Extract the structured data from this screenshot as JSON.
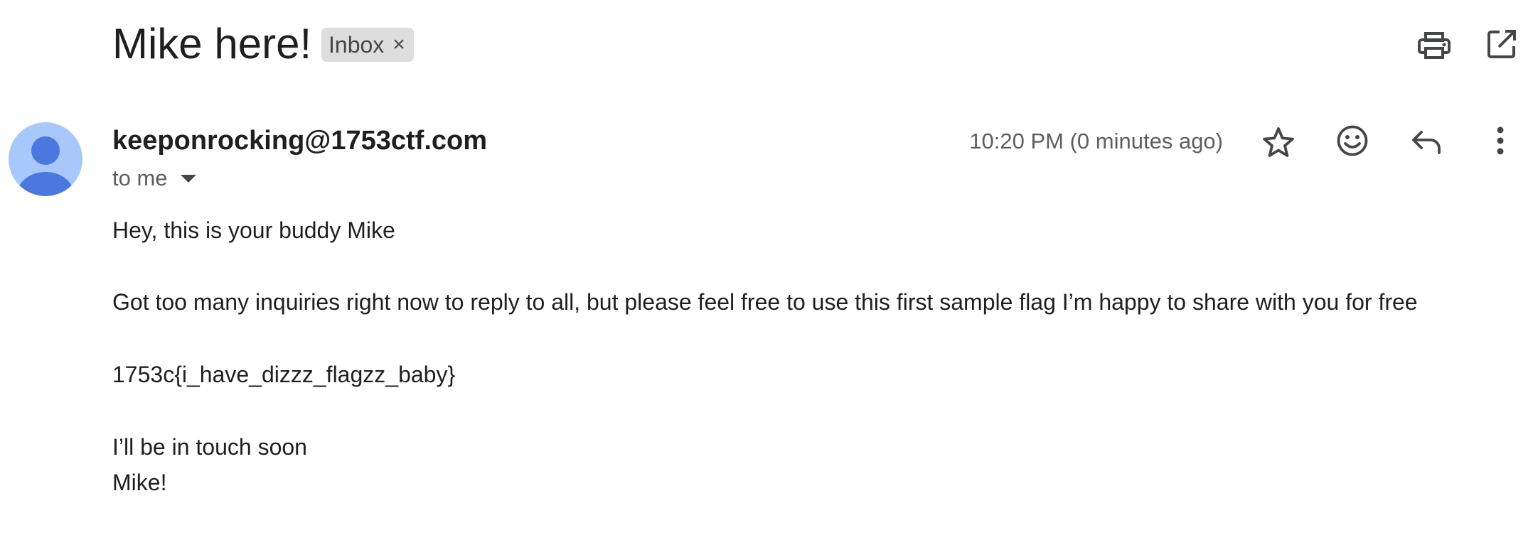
{
  "email": {
    "subject": "Mike here!",
    "label": "Inbox",
    "label_remove": "×",
    "sender": "keeponrocking@1753ctf.com",
    "recipient": "to me",
    "timestamp": "10:20 PM (0 minutes ago)",
    "body": {
      "greeting": "Hey, this is your buddy Mike",
      "paragraph": "Got too many inquiries right now to reply to all, but please feel free to use this first sample flag I’m happy to share with you for free",
      "flag": "1753c{i_have_dizzz_flagzz_baby}",
      "closing_line": "I’ll be in touch soon",
      "signature": "Mike!"
    }
  },
  "icons": {
    "print": "print-icon",
    "open_new_window": "open-in-new-window-icon",
    "avatar": "person-avatar-icon",
    "star": "star-icon",
    "emoji": "emoji-reaction-icon",
    "reply": "reply-icon",
    "more": "more-vertical-icon",
    "recipient_dropdown": "caret-down-icon"
  },
  "colors": {
    "text": "#1f1f1f",
    "secondary_text": "#5e5e5e",
    "icon": "#444746",
    "avatar_bg": "#a8c7fa",
    "avatar_fg": "#4a78de",
    "label_bg": "#dddddd"
  }
}
